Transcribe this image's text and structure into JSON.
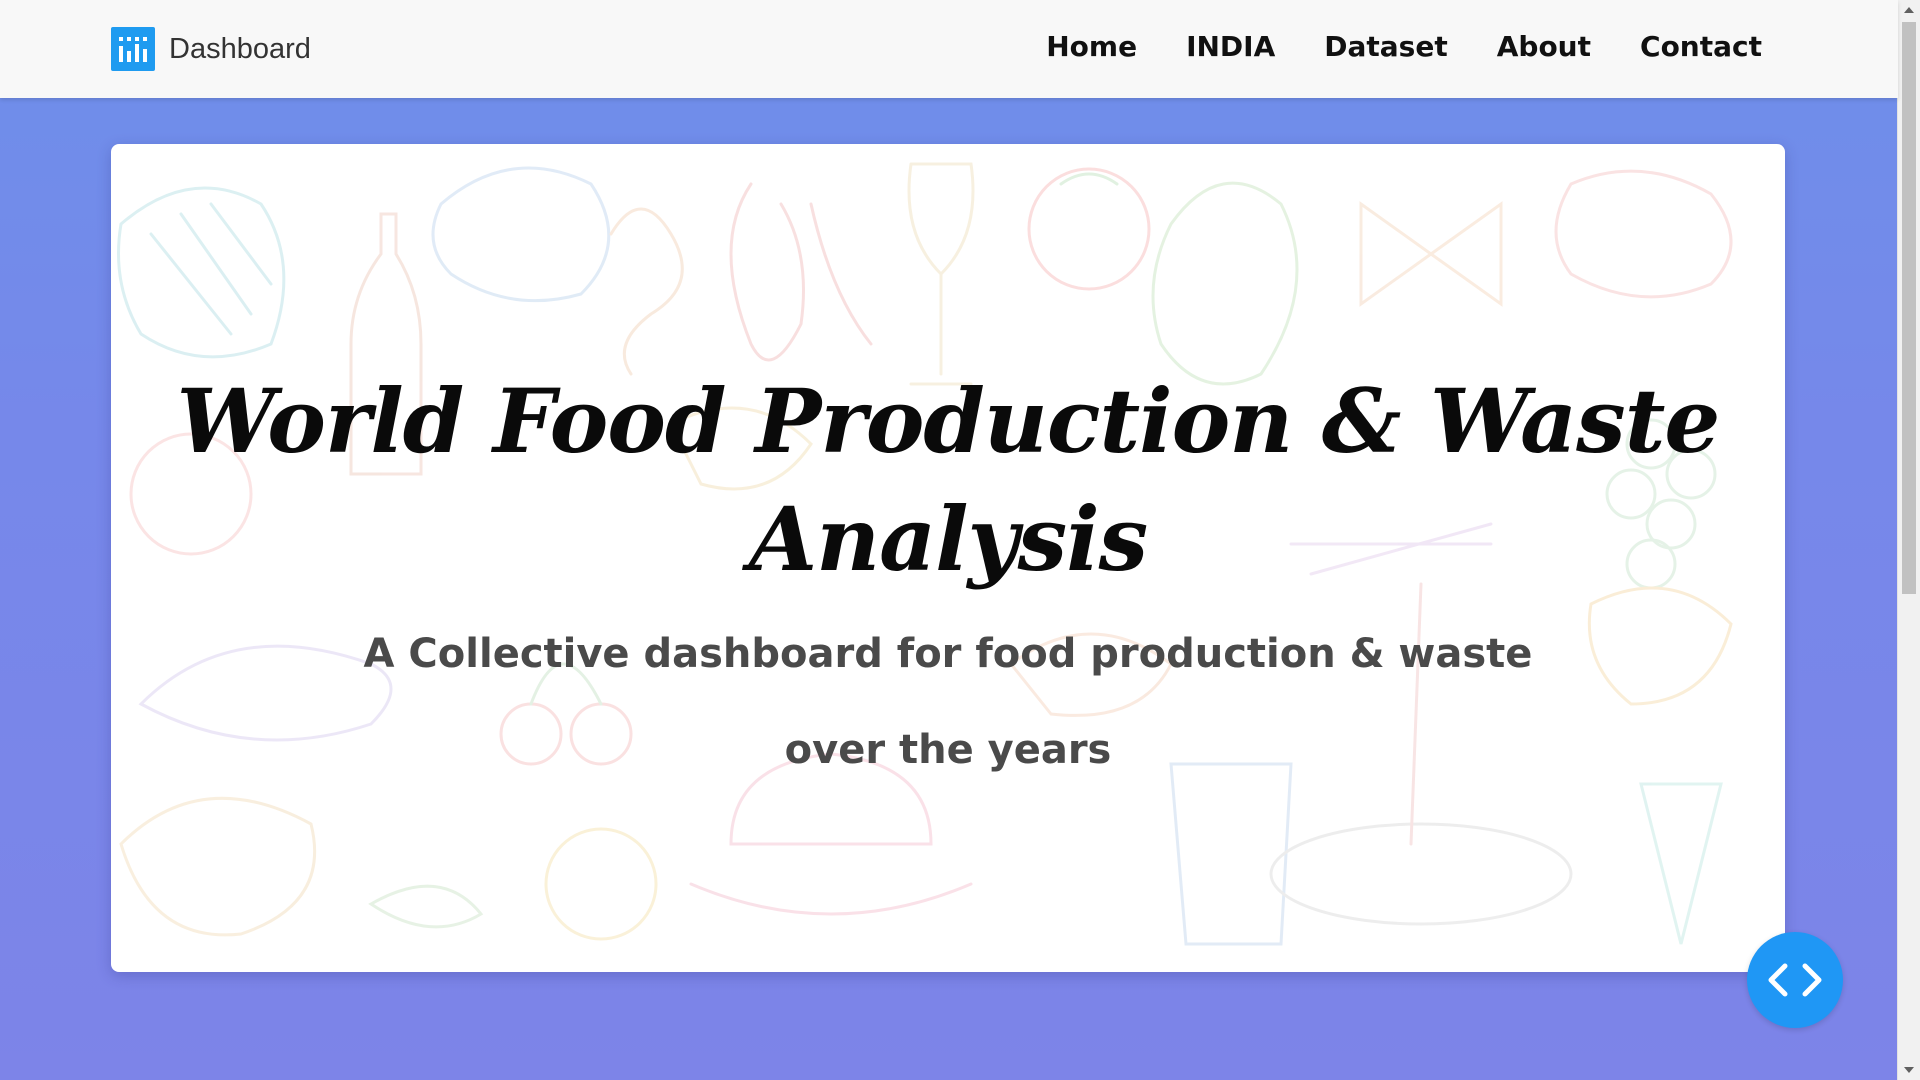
{
  "navbar": {
    "brand_name": "Dashboard",
    "brand_icon": "bar-chart-icon",
    "links": [
      {
        "label": "Home"
      },
      {
        "label": "INDIA"
      },
      {
        "label": "Dataset"
      },
      {
        "label": "About"
      },
      {
        "label": "Contact"
      }
    ]
  },
  "hero": {
    "title": "World Food Production & Waste Analysis",
    "subtitle_line1": "A Collective dashboard for food production & waste",
    "subtitle_line2": "over the years",
    "background": "food-doodles-illustration"
  },
  "fab": {
    "icon": "code-brackets-icon",
    "color": "#1f97f5"
  },
  "colors": {
    "page_background": "#7688ea",
    "navbar_background": "#f8f8f8",
    "brand_icon_color": "#1f9bf0"
  }
}
